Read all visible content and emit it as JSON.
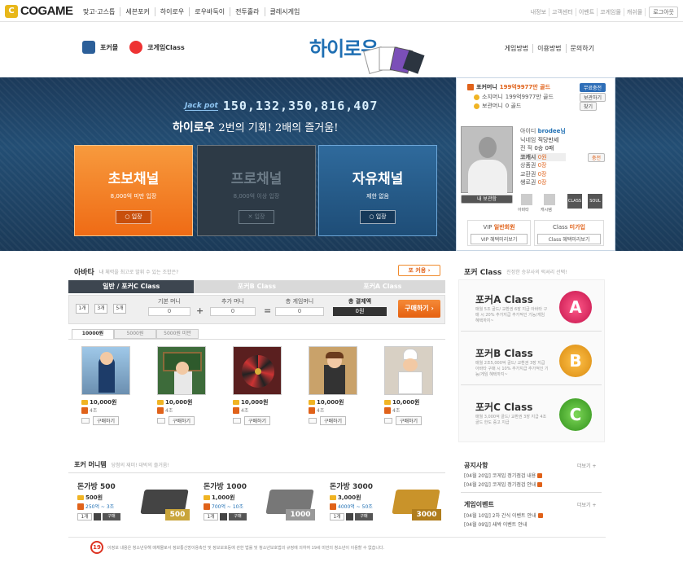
{
  "brand": {
    "logo_text": "COGAME",
    "logo_mark": "C"
  },
  "topnav": [
    "맞고·고스톱",
    "세븐포커",
    "하이로우",
    "로우바둑이",
    "전투홀라",
    "클레시게임"
  ],
  "util": {
    "items": [
      "내정보",
      "고객센터",
      "이벤트",
      "코게임몰",
      "캐쉬몰"
    ],
    "logout": "로그아웃"
  },
  "header": {
    "subnav_poker": "포커몰",
    "subnav_class": "코게임Class",
    "title": "하이로우",
    "links": [
      "게임방법",
      "이용방법",
      "문의하기"
    ]
  },
  "banner": {
    "jackpot_label": "Jack pot",
    "jackpot_value": "150,132,350,816,407",
    "slogan_main": "하이로우",
    "slogan_sub": "2번의 기회! 2배의 즐거움!",
    "channels": [
      {
        "title": "초보채널",
        "desc": "8,000억 미만 입장",
        "button": "입장",
        "state": "active"
      },
      {
        "title": "프로채널",
        "desc": "8,000억 이상 입장",
        "button": "입장",
        "state": "disabled"
      },
      {
        "title": "자유채널",
        "desc": "제한 없음",
        "button": "입장",
        "state": "active"
      }
    ]
  },
  "user": {
    "pokermoney_label": "포커머니",
    "pokermoney_value": "199억9977만 골드",
    "owned_label": "소지머니",
    "owned_value": "199억9977만 골드",
    "safe_label": "보관머니",
    "safe_value": "0 골드",
    "btn_free": "무료충전",
    "btn_safe": "보관하기",
    "btn_find": "찾기",
    "id_label": "아이디",
    "id_value": "brodee님",
    "nick_label": "닉네임",
    "nick_value": "직당만세",
    "record_label": "전 적",
    "record_value": "0승 0패",
    "coin_label": "코캐시",
    "coin_value": "0원",
    "coin_btn": "충전",
    "gift_label": "상품권",
    "gift_value": "0장",
    "exchange_label": "교환권",
    "exchange_value": "0장",
    "ticket_label": "쌩로권",
    "ticket_value": "0장",
    "status_btn": "내 보관함",
    "icons": [
      "아바타",
      "캐시템",
      "CLASS",
      "SOUL"
    ],
    "vip_title": "VIP",
    "vip_status": "일반회원",
    "vip_btn": "VIP 혜택미리보기",
    "class_title": "Class",
    "class_status": "미가입",
    "class_btn": "Class 혜택미리보기"
  },
  "avatar": {
    "title": "아바타",
    "subtitle": "내 체력을 최고로 발휘 수 있는 조합은?",
    "poker_btn": "포 커용",
    "tabs": [
      "일반 / 포커C Class",
      "포커B Class",
      "포커A Class"
    ],
    "months": [
      "1개",
      "3개",
      "5개"
    ],
    "base_label": "기본 머니",
    "base_value": "0",
    "extra_label": "추가 머니",
    "extra_value": "0",
    "total_label": "총 게임머니",
    "total_value": "0",
    "price_label": "총 결제액",
    "price_value": "0원",
    "buy_btn": "구매하기",
    "price_tabs": [
      "10000원",
      "5000원",
      "5000원 미만"
    ],
    "items": [
      {
        "price": "10,000원",
        "count": "4조",
        "buy": "구매하기"
      },
      {
        "price": "10,000원",
        "count": "4조",
        "buy": "구매하기"
      },
      {
        "price": "10,000원",
        "count": "4조",
        "buy": "구매하기"
      },
      {
        "price": "10,000원",
        "count": "4조",
        "buy": "구매하기"
      },
      {
        "price": "10,000원",
        "count": "4조",
        "buy": "구매하기"
      }
    ]
  },
  "pokerclass": {
    "title": "포커 Class",
    "subtitle": "진정한 승부사의 럭셔리 선택!",
    "classes": [
      {
        "name": "포커A Class",
        "desc": "매월 5조 골드/ 교환권 6장 지급 아바타 구매 시 20% 추가지급 추가적인 기능/게임 혜택까지~",
        "badge": "A"
      },
      {
        "name": "포커B Class",
        "desc": "매월 2조5,000억 골드/ 교환권 3장 지급 아바타 구매 시 10% 추가지급 추가적인 기능/게임 혜택까지~",
        "badge": "B"
      },
      {
        "name": "포커C Class",
        "desc": "매월 3,000억 골드/ 교환권 3장 지급 4조 골드 한도 증고 지급",
        "badge": "C"
      }
    ]
  },
  "pokermoney": {
    "title": "포커 머니템",
    "subtitle": "당첨의 재미! 대박의 즐거움!",
    "bags": [
      {
        "name": "돈가방 500",
        "price": "500원",
        "range": "250억 ~ 3조",
        "qty": "1개",
        "btn": "구매",
        "label": "500"
      },
      {
        "name": "돈가방 1000",
        "price": "1,000원",
        "range": "700억 ~ 10조",
        "qty": "1개",
        "btn": "구매",
        "label": "1000"
      },
      {
        "name": "돈가방 3000",
        "price": "3,000원",
        "range": "4000억 ~ 50조",
        "qty": "1개",
        "btn": "구매",
        "label": "3000"
      }
    ]
  },
  "notices": {
    "title": "공지사항",
    "more": "더보기",
    "items": [
      "[04월 20일] 코게임 정기점검 내용",
      "[04월 20일] 코게임 정기점검 안내"
    ]
  },
  "events": {
    "title": "게임이벤트",
    "more": "더보기",
    "items": [
      "[04월 10일] 2차 간식 이벤트 안내",
      "[04월 09일] 새싹 이벤트 안내"
    ]
  },
  "footer": {
    "age": "19",
    "text": "이정보 내용은 청소년유해 매체물로서 정보통신망이용촉진 및 정보보호등에 관한 법률 및 청소년보호법의 규정에 의하여 19세 미만의 청소년이 이용할 수 없습니다."
  },
  "colors": {
    "accent_orange": "#ef6b15",
    "accent_blue": "#1f6fb3",
    "banner_bg": "#1c3a5a"
  }
}
